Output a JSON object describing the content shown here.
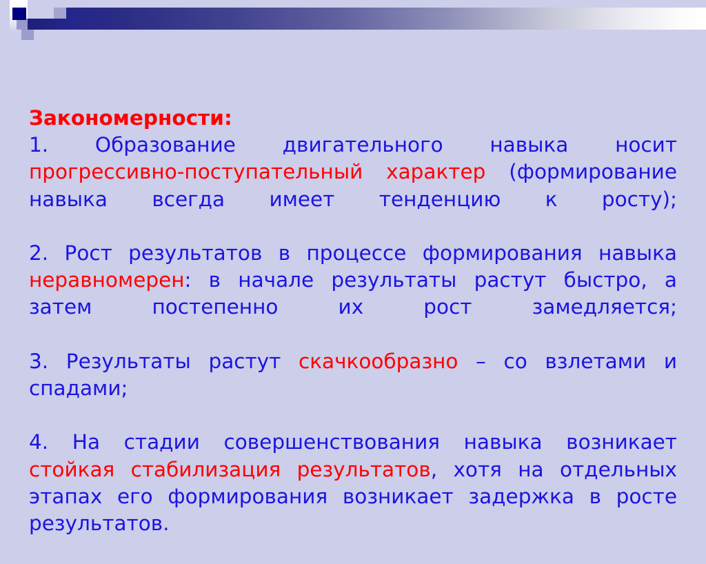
{
  "slide": {
    "background_color": "#ccceea",
    "accent_navy": "#000080",
    "heading_color": "#ff0000",
    "body_color": "#1c14e0",
    "title": "Закономерности:",
    "items": [
      {
        "number": "1.",
        "segments": [
          {
            "text": "1.   Образование двигательного навыка носит ",
            "color": "blue"
          },
          {
            "text": "прогрессивно-поступательный характер ",
            "color": "red"
          },
          {
            "text": "(формирование навыка всегда имеет тенденцию к росту);",
            "color": "blue"
          }
        ]
      },
      {
        "number": "2.",
        "segments": [
          {
            "text": "2. Рост результатов в процессе формирования навыка ",
            "color": "blue"
          },
          {
            "text": "неравномерен",
            "color": "red"
          },
          {
            "text": ": в начале результаты растут быстро, а затем постепенно их рост замедляется;",
            "color": "blue"
          }
        ]
      },
      {
        "number": "3.",
        "segments": [
          {
            "text": "3. Результаты растут ",
            "color": "blue"
          },
          {
            "text": "скачкообразно",
            "color": "red"
          },
          {
            "text": " – со взлетами и спадами;",
            "color": "blue"
          }
        ]
      },
      {
        "number": "4.",
        "segments": [
          {
            "text": "4. На стадии совершенствования навыка возникает ",
            "color": "blue"
          },
          {
            "text": "стойкая стабилизация результатов",
            "color": "red"
          },
          {
            "text": ", хотя на отдельных этапах его формирования возникает задержка в росте результатов.",
            "color": "blue"
          }
        ]
      }
    ],
    "decoration": {
      "band_gradient_from": "#1e1f78",
      "band_gradient_to": "#ffffff",
      "square_navy": "#000080",
      "square_mid": "#9799cb",
      "square_light": "#a3a5cf"
    }
  }
}
